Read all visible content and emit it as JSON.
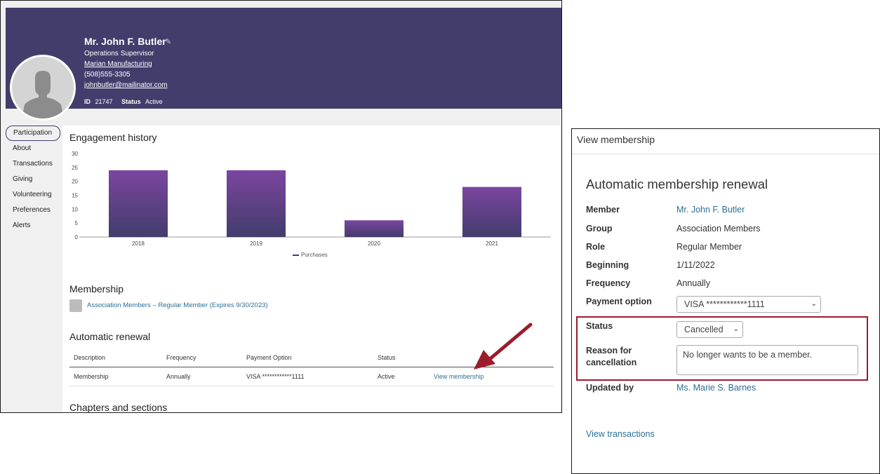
{
  "profile": {
    "name": "Mr. John F. Butler",
    "title": "Operations Supervisor",
    "company": "Marian Manufacturing",
    "phone": "(508)555-3305",
    "email": "johnbutler@mailinator.com",
    "id_label": "ID",
    "id_value": "21747",
    "status_label": "Status",
    "status_value": "Active"
  },
  "nav": {
    "items": [
      "Participation",
      "About",
      "Transactions",
      "Giving",
      "Volunteering",
      "Preferences",
      "Alerts"
    ],
    "active": "Participation"
  },
  "engagement": {
    "title": "Engagement history"
  },
  "chart_data": {
    "type": "bar",
    "categories": [
      "2018",
      "2019",
      "2020",
      "2021"
    ],
    "series": [
      {
        "name": "Purchases",
        "values": [
          24,
          24,
          6,
          18
        ]
      }
    ],
    "ylim": [
      0,
      30
    ],
    "yticks": [
      0,
      5,
      10,
      15,
      20,
      25,
      30
    ],
    "legend": "bottom",
    "bar_color": "#6b3f94"
  },
  "membership": {
    "title": "Membership",
    "link": "Association Members – Regular Member (Expires 9/30/2023)"
  },
  "renewal": {
    "title": "Automatic renewal",
    "columns": [
      "Description",
      "Frequency",
      "Payment Option",
      "Status"
    ],
    "row": {
      "description": "Membership",
      "frequency": "Annually",
      "payment": "VISA ************1111",
      "status": "Active",
      "action": "View membership"
    }
  },
  "chapters": {
    "title": "Chapters and sections"
  },
  "panel": {
    "title": "View membership",
    "heading": "Automatic membership renewal",
    "member_label": "Member",
    "member_value": "Mr. John F. Butler",
    "group_label": "Group",
    "group_value": "Association Members",
    "role_label": "Role",
    "role_value": "Regular Member",
    "beginning_label": "Beginning",
    "beginning_value": "1/11/2022",
    "frequency_label": "Frequency",
    "frequency_value": "Annually",
    "payment_label": "Payment option",
    "payment_value": "VISA ************1111",
    "status_label": "Status",
    "status_value": "Cancelled",
    "reason_label": "Reason for cancellation",
    "reason_value": "No longer wants to be a member.",
    "updated_label": "Updated by",
    "updated_value": "Ms. Marie S. Barnes",
    "transactions_link": "View transactions"
  },
  "colors": {
    "banner": "#433d6c",
    "accent_link": "#2a6f97",
    "highlight": "#9b1c2a",
    "arrow": "#9b1c2a"
  }
}
